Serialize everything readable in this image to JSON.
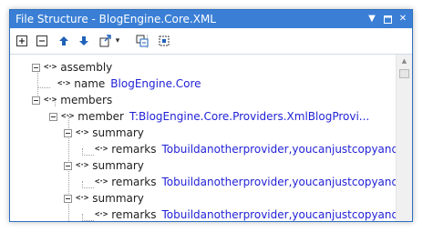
{
  "window": {
    "title": "File Structure - BlogEngine.Core.XML",
    "dropdown_icon": "dropdown-triangle",
    "pin_icon": "maximize-square",
    "close_icon": "close-x"
  },
  "toolbar": {
    "buttons": [
      {
        "name": "expand-all",
        "glyph": "⊞"
      },
      {
        "name": "collapse-all",
        "glyph": "⊟"
      },
      {
        "name": "move-up",
        "glyph": "↑"
      },
      {
        "name": "move-down",
        "glyph": "↓"
      },
      {
        "name": "export",
        "glyph": "⤴"
      },
      {
        "name": "dropdown",
        "glyph": "▾"
      },
      {
        "name": "track-caret",
        "glyph": "⇄"
      },
      {
        "name": "select-in-tree",
        "glyph": "⌖"
      }
    ]
  },
  "tree": {
    "nodes": [
      {
        "kind": "element",
        "label": "assembly"
      },
      {
        "kind": "attribute",
        "label": "name",
        "value": "BlogEngine.Core"
      },
      {
        "kind": "element",
        "label": "members"
      },
      {
        "kind": "element",
        "label": "member",
        "value": "T:BlogEngine.Core.Providers.XmlBlogProvi..."
      },
      {
        "kind": "element",
        "label": "summary"
      },
      {
        "kind": "attribute",
        "label": "remarks",
        "value": "Tobuildanotherprovider,youcanjustcopyand..."
      },
      {
        "kind": "element",
        "label": "summary"
      },
      {
        "kind": "attribute",
        "label": "remarks",
        "value": "Tobuildanotherprovider,youcanjustcopyand..."
      },
      {
        "kind": "element",
        "label": "summary"
      },
      {
        "kind": "attribute",
        "label": "remarks",
        "value": "Tobuildanotherprovider,youcanjustcopyand..."
      }
    ]
  }
}
